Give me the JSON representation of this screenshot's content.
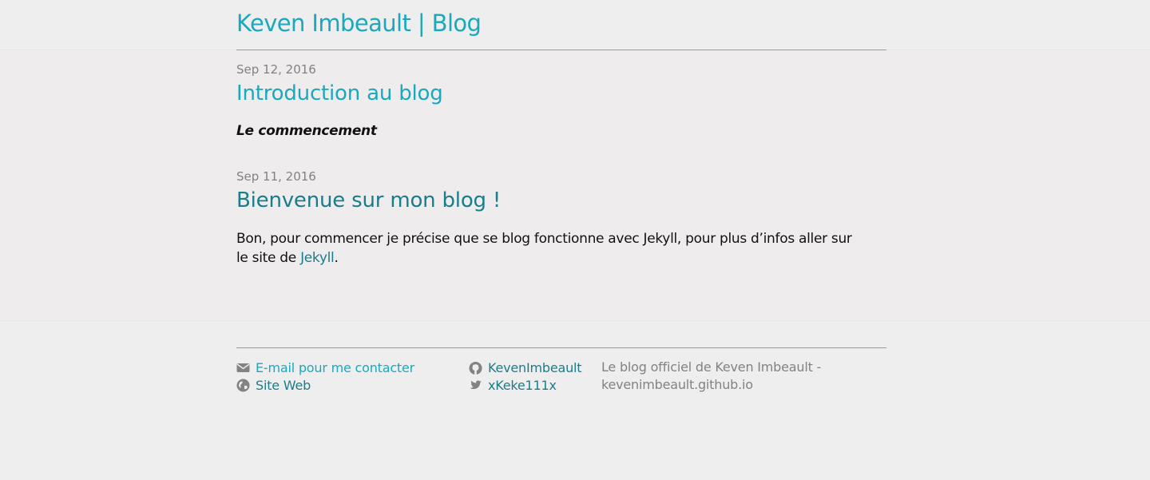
{
  "header": {
    "site_title": "Keven Imbeault | Blog"
  },
  "posts": [
    {
      "date": "Sep 12, 2016",
      "title": "Introduction au blog",
      "excerpt_em": "Le commencement"
    },
    {
      "date": "Sep 11, 2016",
      "title": "Bienvenue sur mon blog !",
      "excerpt_before": "Bon, pour commencer je précise que se blog fonctionne avec Jekyll, pour plus d’infos aller sur le site de ",
      "excerpt_link": "Jekyll",
      "excerpt_after": "."
    }
  ],
  "footer": {
    "email_label": "E-mail pour me contacter",
    "website_label": "Site Web",
    "github_label": "KevenImbeault",
    "twitter_label": "xKeke111x",
    "description": "Le blog officiel de Keven Imbeault - kevenimbeault.github.io"
  },
  "colors": {
    "title_accent": "#1aa9bc",
    "link_dark": "#1a7d8a",
    "muted_text": "#828282",
    "background": "#eeeced"
  },
  "icons": {
    "email": "envelope-icon",
    "website": "globe-icon",
    "github": "github-icon",
    "twitter": "twitter-icon"
  }
}
